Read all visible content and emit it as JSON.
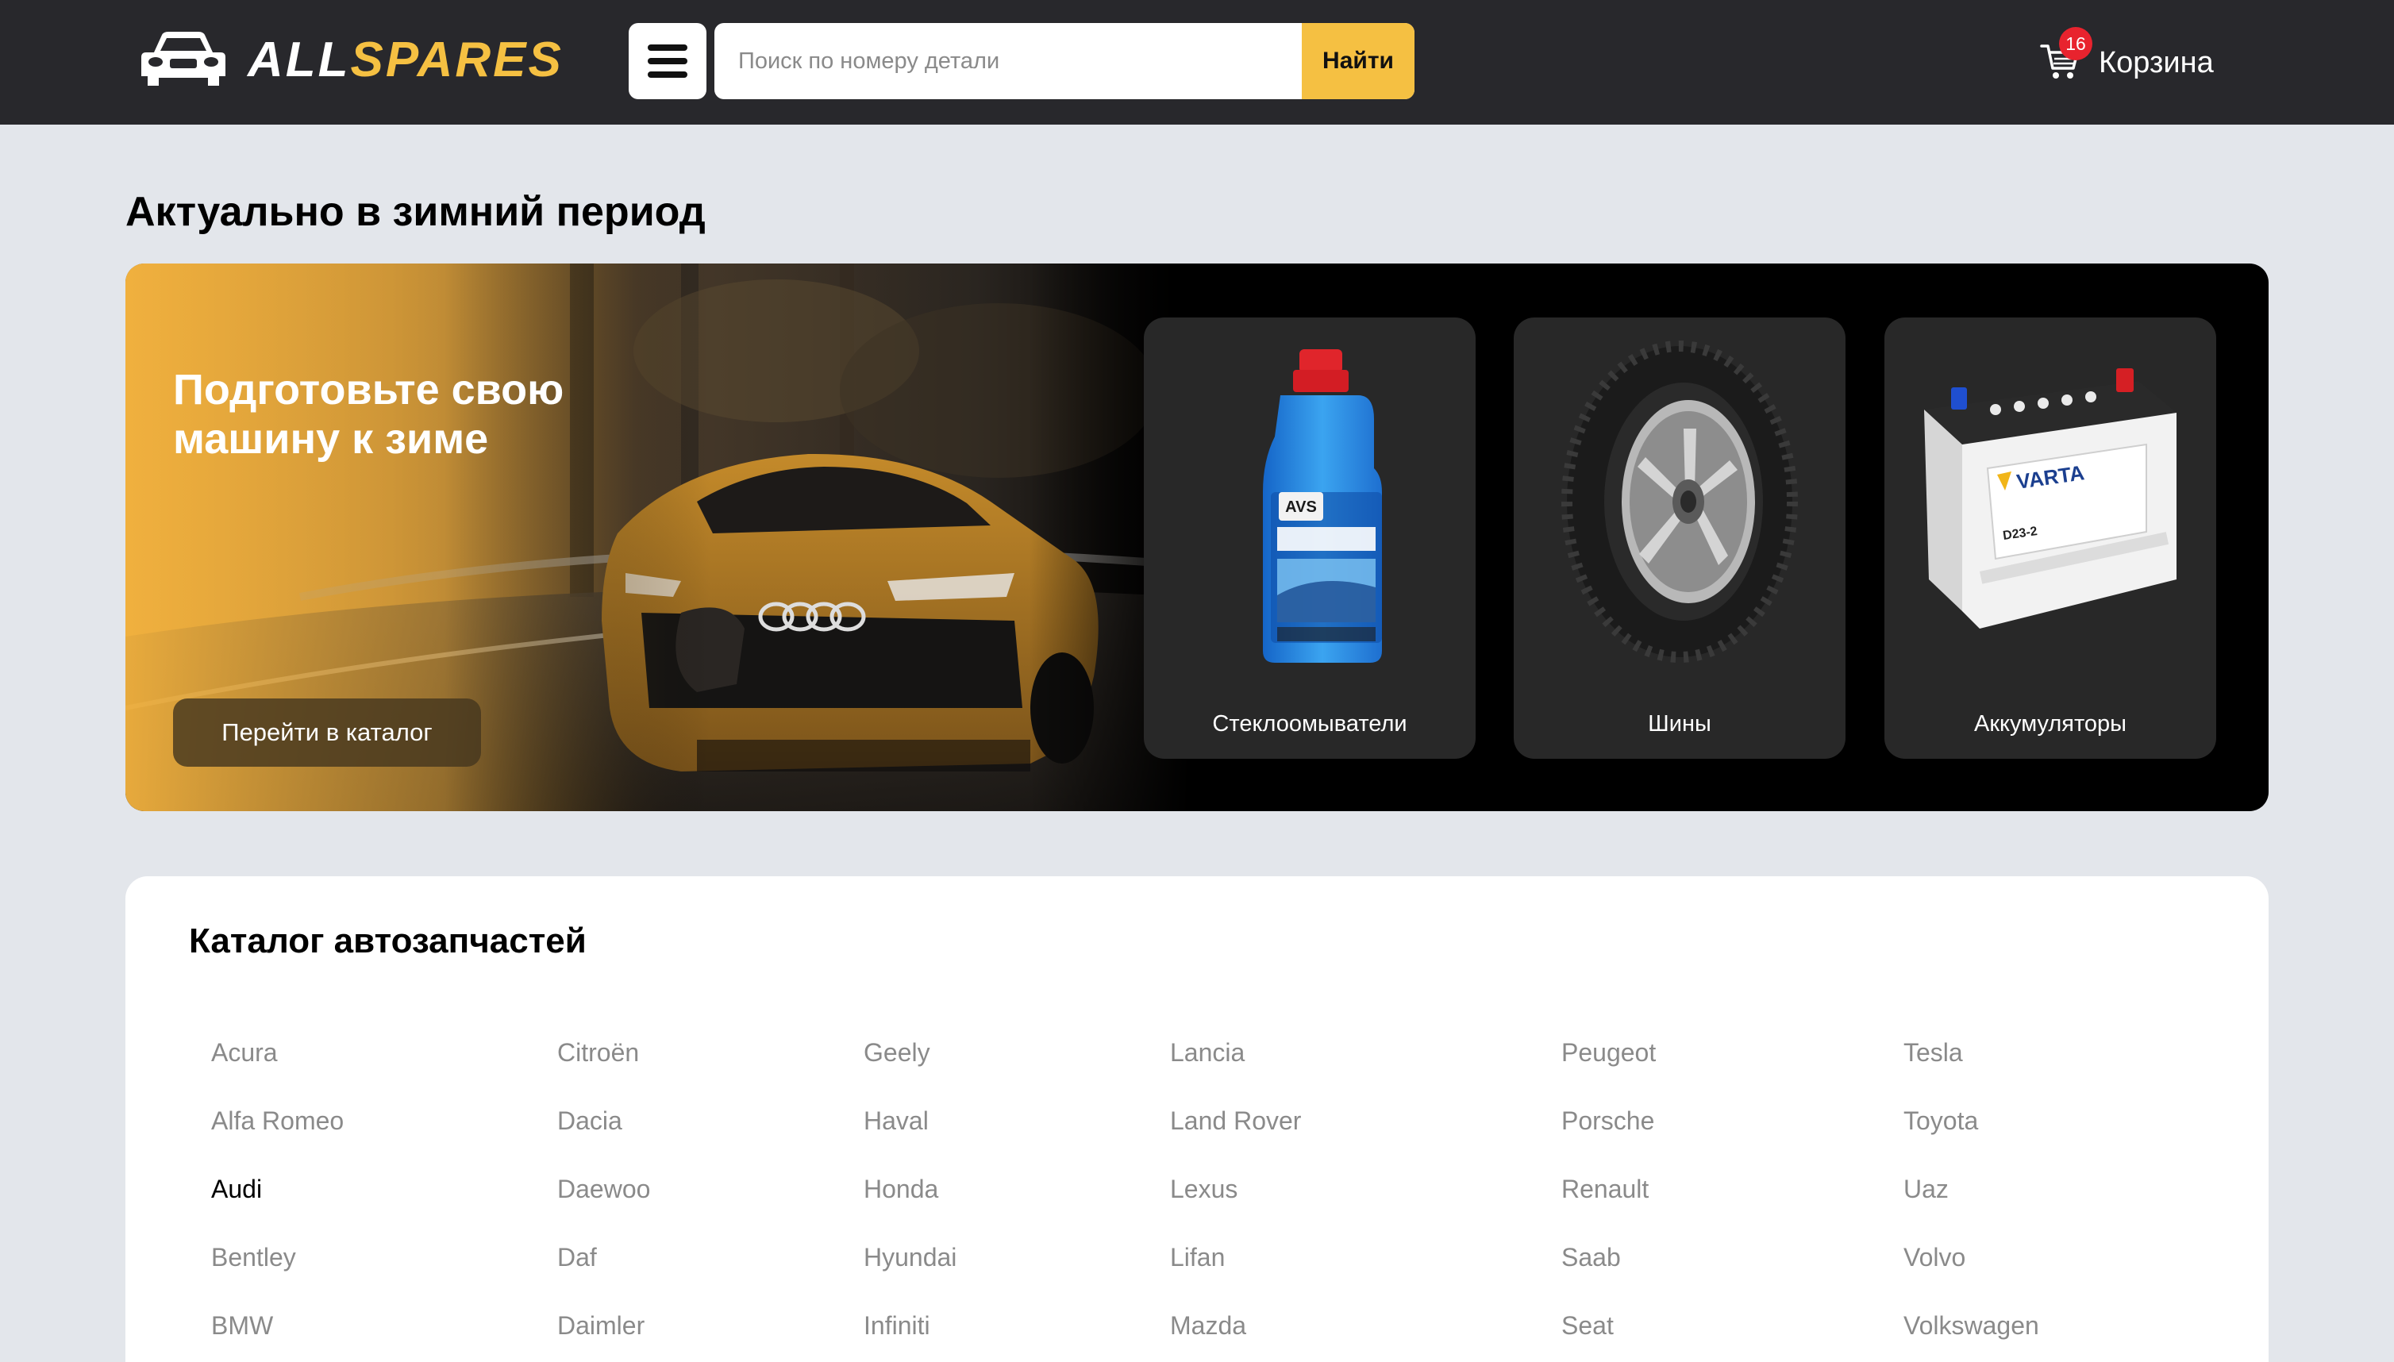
{
  "header": {
    "logo_part1": "ALL",
    "logo_part2": "SPARES",
    "search_placeholder": "Поиск по номеру детали",
    "search_button": "Найти",
    "cart_label": "Корзина",
    "cart_count": "16"
  },
  "winter": {
    "section_title": "Актуально в зимний период",
    "banner_heading": "Подготовьте свою машину к зиме",
    "cta_label": "Перейти в каталог",
    "categories": [
      {
        "label": "Стеклоомыватели",
        "icon": "washer-fluid-bottle"
      },
      {
        "label": "Шины",
        "icon": "studded-tire"
      },
      {
        "label": "Аккумуляторы",
        "icon": "car-battery"
      }
    ],
    "product_labels": {
      "bottle_brand": "AVS",
      "battery_brand": "VARTA",
      "battery_model": "D23-2"
    }
  },
  "catalog": {
    "title": "Каталог автозапчастей",
    "columns": [
      [
        "Acura",
        "Alfa Romeo",
        "Audi",
        "Bentley",
        "BMW"
      ],
      [
        "Citroën",
        "Dacia",
        "Daewoo",
        "Daf",
        "Daimler"
      ],
      [
        "Geely",
        "Haval",
        "Honda",
        "Hyundai",
        "Infiniti"
      ],
      [
        "Lancia",
        "Land Rover",
        "Lexus",
        "Lifan",
        "Mazda"
      ],
      [
        "Peugeot",
        "Porsche",
        "Renault",
        "Saab",
        "Seat"
      ],
      [
        "Tesla",
        "Toyota",
        "Uaz",
        "Volvo",
        "Volkswagen"
      ]
    ],
    "active_brand": "Audi"
  },
  "colors": {
    "header_bg": "#28282c",
    "accent": "#f5c042",
    "page_bg": "#e3e6eb",
    "badge": "#e8232e",
    "brand_text": "#8a8a8a"
  }
}
